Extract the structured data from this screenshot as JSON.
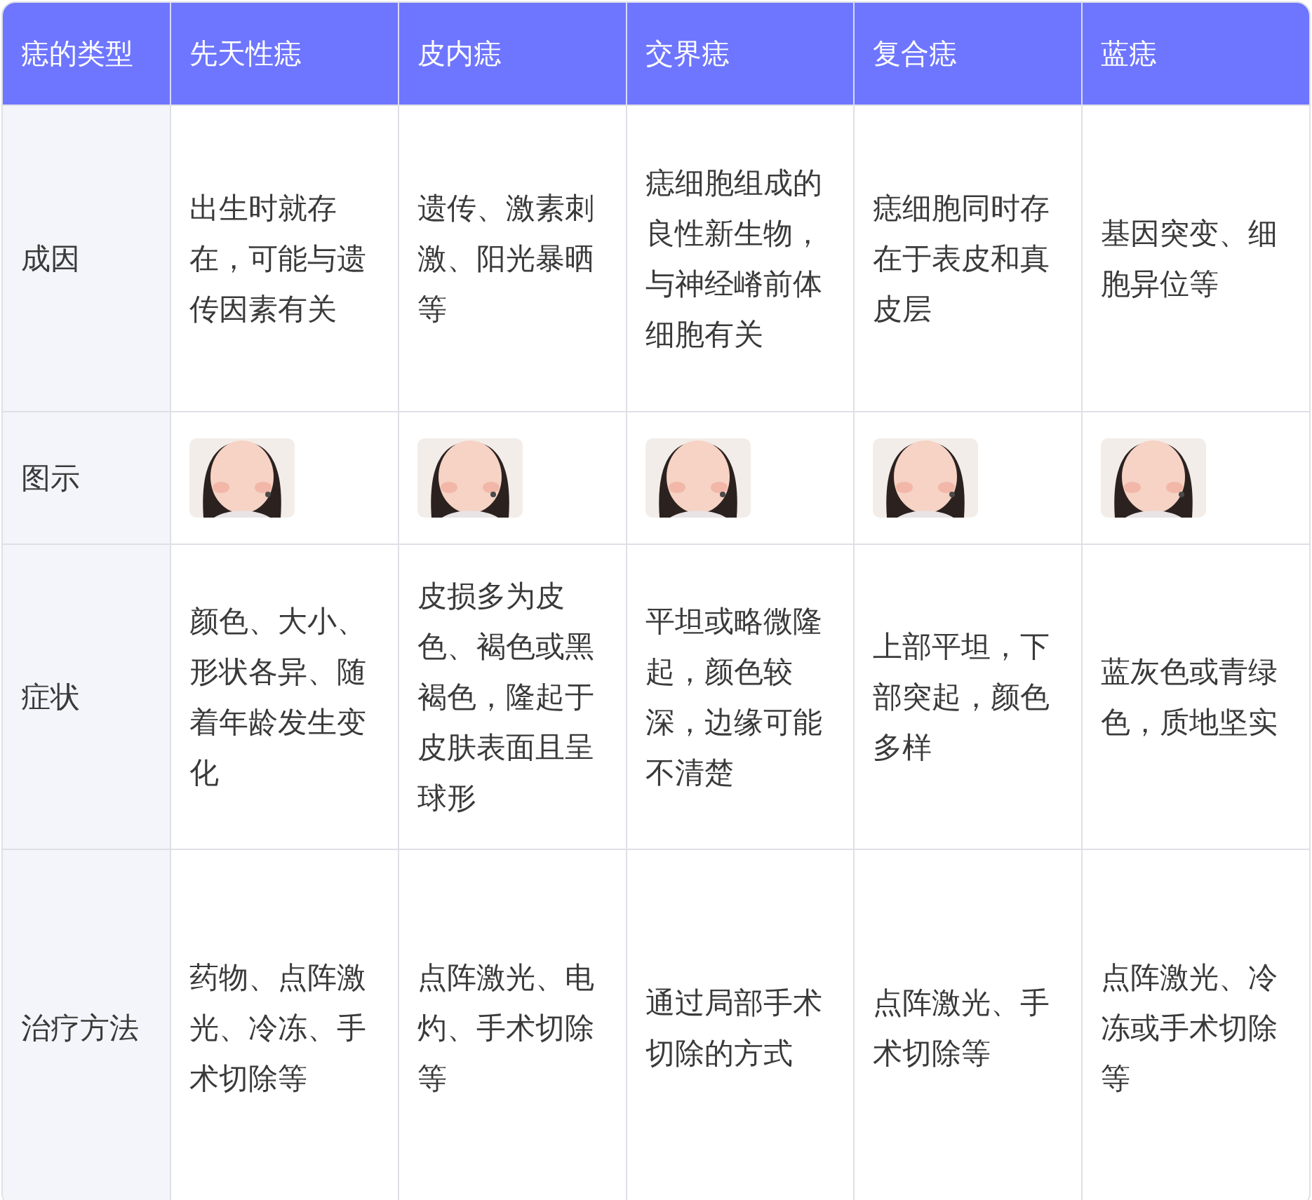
{
  "table": {
    "columns": [
      "痣的类型",
      "先天性痣",
      "皮内痣",
      "交界痣",
      "复合痣",
      "蓝痣"
    ],
    "rows": [
      {
        "kind": "text",
        "cells": [
          "成因",
          "出生时就存在，可能与遗传因素有关",
          "遗传、激素刺激、阳光暴晒等",
          "痣细胞组成的良性新生物，与神经嵴前体细胞有关",
          "痣细胞同时存在于表皮和真皮层",
          "基因突变、细胞异位等"
        ]
      },
      {
        "kind": "picture",
        "cells": [
          "图示",
          {
            "kind": "picture"
          },
          {
            "kind": "picture"
          },
          {
            "kind": "picture"
          },
          {
            "kind": "picture"
          },
          {
            "kind": "picture"
          }
        ]
      },
      {
        "kind": "text",
        "cells": [
          "症状",
          "颜色、大小、形状各异、随着年龄发生变化",
          "皮损多为皮色、褐色或黑褐色，隆起于皮肤表面且呈球形",
          "平坦或略微隆起，颜色较深，边缘可能不清楚",
          "上部平坦，下部突起，颜色多样",
          "蓝灰色或青绿色，质地坚实"
        ]
      },
      {
        "kind": "text",
        "cells": [
          "治疗方法",
          "药物、点阵激光、冷冻、手术切除等",
          "点阵激光、电灼、手术切除等",
          "通过局部手术切除的方式",
          "点阵激光、手术切除等",
          "点阵激光、冷冻或手术切除等"
        ]
      }
    ]
  }
}
